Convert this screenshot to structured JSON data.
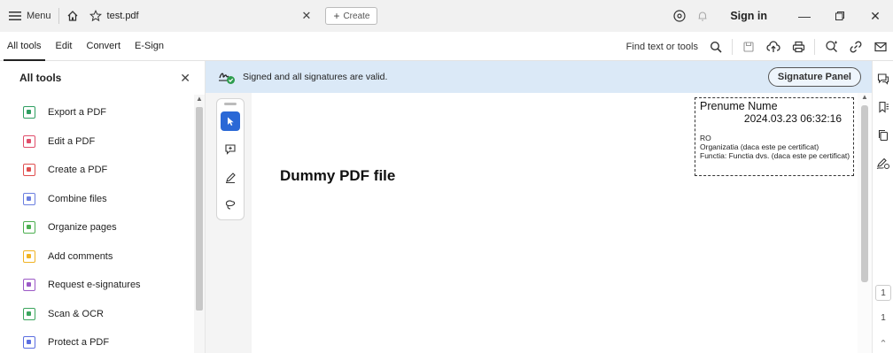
{
  "titlebar": {
    "menu_label": "Menu",
    "tab_title": "test.pdf",
    "create_label": "Create",
    "sign_in": "Sign in"
  },
  "toolbar": {
    "tabs": [
      "All tools",
      "Edit",
      "Convert",
      "E-Sign"
    ],
    "find_text": "Find text or tools"
  },
  "left_panel": {
    "title": "All tools",
    "items": [
      {
        "label": "Export a PDF",
        "color": "#2f9e61"
      },
      {
        "label": "Edit a PDF",
        "color": "#e04e6b"
      },
      {
        "label": "Create a PDF",
        "color": "#e04e4e"
      },
      {
        "label": "Combine files",
        "color": "#6b7fe0"
      },
      {
        "label": "Organize pages",
        "color": "#4caf50"
      },
      {
        "label": "Add comments",
        "color": "#f0b323"
      },
      {
        "label": "Request e-signatures",
        "color": "#9b59c6"
      },
      {
        "label": "Scan & OCR",
        "color": "#3ba55d"
      },
      {
        "label": "Protect a PDF",
        "color": "#5b6ee0"
      }
    ]
  },
  "signature_banner": {
    "text": "Signed and all signatures are valid.",
    "panel_button": "Signature Panel"
  },
  "document": {
    "heading": "Dummy PDF file",
    "signature": {
      "name": "Prenume Nume",
      "date": "2024.03.23 06:32:16",
      "line1": "RO",
      "line2": "Organizatia (daca este pe certificat)",
      "line3": "Functia: Functia dvs. (daca este pe certificat)"
    }
  },
  "right_rail": {
    "page_current": "1",
    "page_total": "1"
  },
  "colors": {
    "banner_bg": "#dbe9f7",
    "accent": "#2a68d6"
  }
}
